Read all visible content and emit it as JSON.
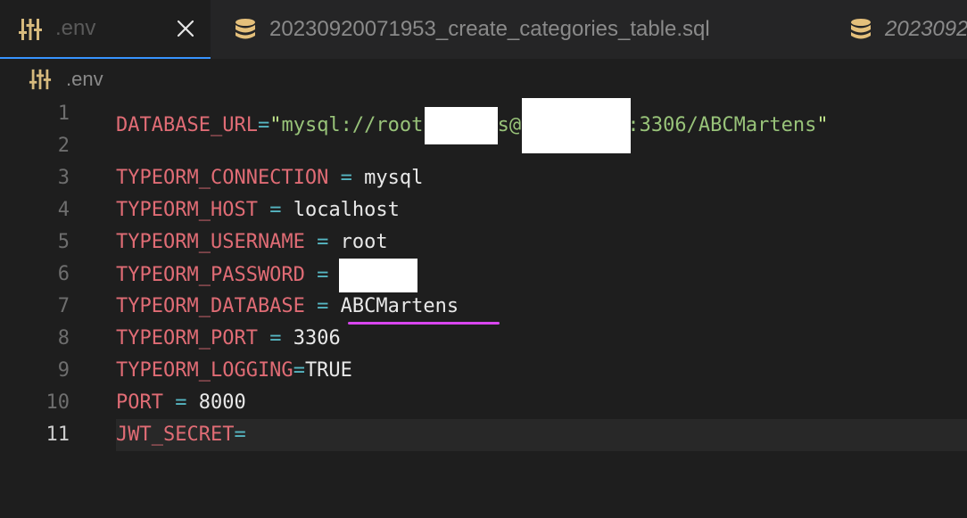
{
  "tabs": [
    {
      "label": ".env",
      "icon": "settings-sliders-icon",
      "active": true
    },
    {
      "label": "20230920071953_create_categories_table.sql",
      "icon": "database-icon",
      "active": false
    },
    {
      "label": "2023092",
      "icon": "database-icon",
      "active": false
    }
  ],
  "breadcrumb": {
    "label": ".env",
    "icon": "settings-sliders-icon"
  },
  "lines": [
    {
      "n": "1",
      "key": "DATABASE_URL",
      "op": "=",
      "q1": "\"",
      "val1": "mysql://root:",
      "val2": "s@1",
      "val3": ":3306/ABCMartens",
      "q2": "\""
    },
    {
      "n": "2"
    },
    {
      "n": "3",
      "key": "TYPEORM_CONNECTION",
      "op": " = ",
      "val": "mysql"
    },
    {
      "n": "4",
      "key": "TYPEORM_HOST",
      "op": " = ",
      "val": "localhost"
    },
    {
      "n": "5",
      "key": "TYPEORM_USERNAME",
      "op": " = ",
      "val": "root"
    },
    {
      "n": "6",
      "key": "TYPEORM_PASSWORD",
      "op": " = ",
      "val": ""
    },
    {
      "n": "7",
      "key": "TYPEORM_DATABASE",
      "op": " = ",
      "val": "ABCMartens"
    },
    {
      "n": "8",
      "key": "TYPEORM_PORT",
      "op": " = ",
      "val": "3306"
    },
    {
      "n": "9",
      "key": "TYPEORM_LOGGING",
      "op": "=",
      "val": "TRUE"
    },
    {
      "n": "10",
      "key": "PORT",
      "op": " = ",
      "val": "8000"
    },
    {
      "n": "11",
      "key": "JWT_SECRET",
      "op": "=",
      "val": ""
    }
  ]
}
